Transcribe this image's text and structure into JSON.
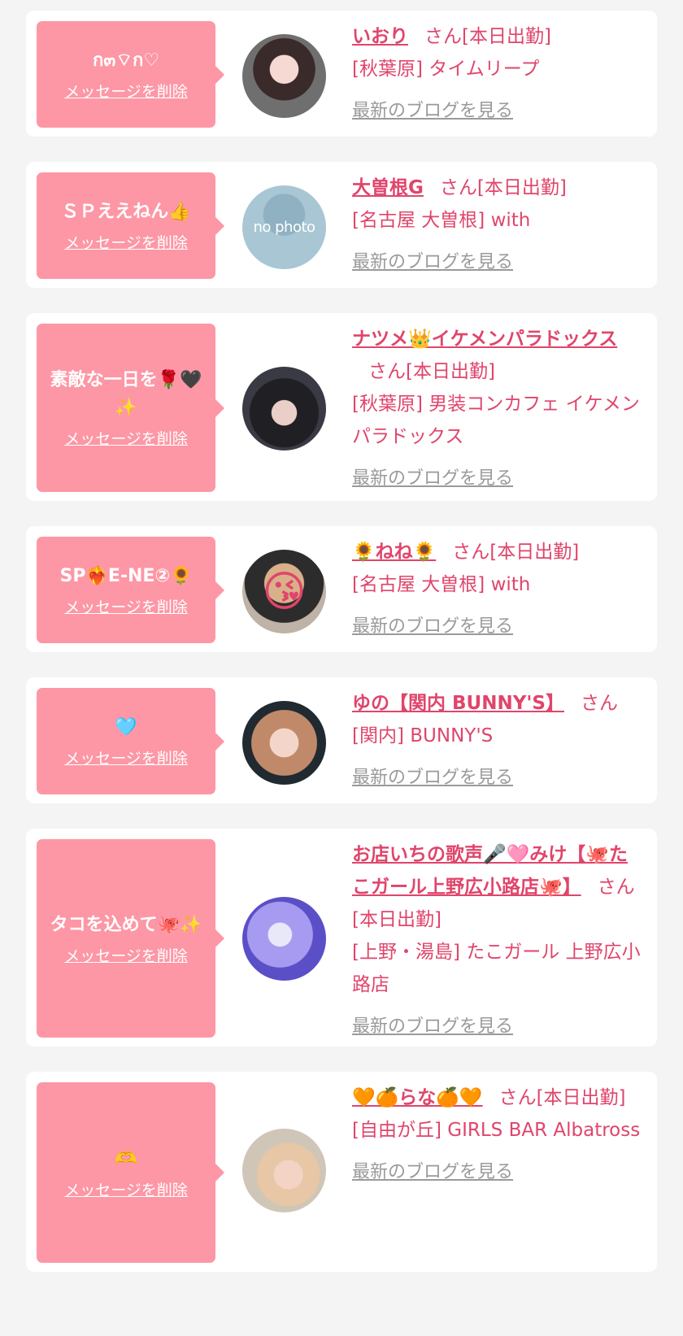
{
  "delete_label": "メッセージを削除",
  "blog_label": "最新のブログを見る",
  "colors": {
    "accent": "#e0456b",
    "bubble": "#fd97a5",
    "background": "#f4f4f4",
    "card": "#ffffff",
    "link_gray": "#9a9a9a"
  },
  "items": [
    {
      "message": "ก๓⌔ก♡",
      "name": "いおり",
      "suffix": "さん[本日出勤]",
      "shop": "[秋葉原] タイムリープ",
      "avatar_icon": "girl-photo-icon"
    },
    {
      "message": "ＳＰええねん👍",
      "name": "大曽根G",
      "suffix": "さん[本日出勤]",
      "shop": "[名古屋 大曽根] with",
      "avatar_icon": "no-photo-icon",
      "avatar_text": "no photo"
    },
    {
      "message": "素敵な一日を🌹🖤✨",
      "name": "ナツメ👑イケメンパラドックス",
      "suffix": "さん[本日出勤]",
      "shop": "[秋葉原] 男装コンカフェ イケメンパラドックス",
      "avatar_icon": "cast-photo-icon"
    },
    {
      "message": "SP❤️‍🔥E-NE②🌻",
      "name": "🌻ねね🌻",
      "suffix": "さん[本日出勤]",
      "shop": "[名古屋 大曽根] with",
      "avatar_icon": "kiss-emoji-photo-icon"
    },
    {
      "message": "🩵",
      "name": "ゆの【関内 BUNNY'S】",
      "suffix": "さん",
      "shop": "[関内] BUNNY'S",
      "avatar_icon": "girl-photo-icon"
    },
    {
      "message": "タコを込めて🐙✨",
      "name": "お店いちの歌声🎤🩷みけ【🐙たこガール上野広小路店🐙】",
      "suffix": "さん[本日出勤]",
      "shop": "[上野・湯島] たこガール 上野広小路店",
      "avatar_icon": "purple-photo-icon"
    },
    {
      "message": "🫶",
      "name": "🧡🍊らな🍊🧡",
      "suffix": "さん[本日出勤]",
      "shop": "[自由が丘] GIRLS BAR Albatross",
      "avatar_icon": "girl-photo-icon"
    }
  ]
}
